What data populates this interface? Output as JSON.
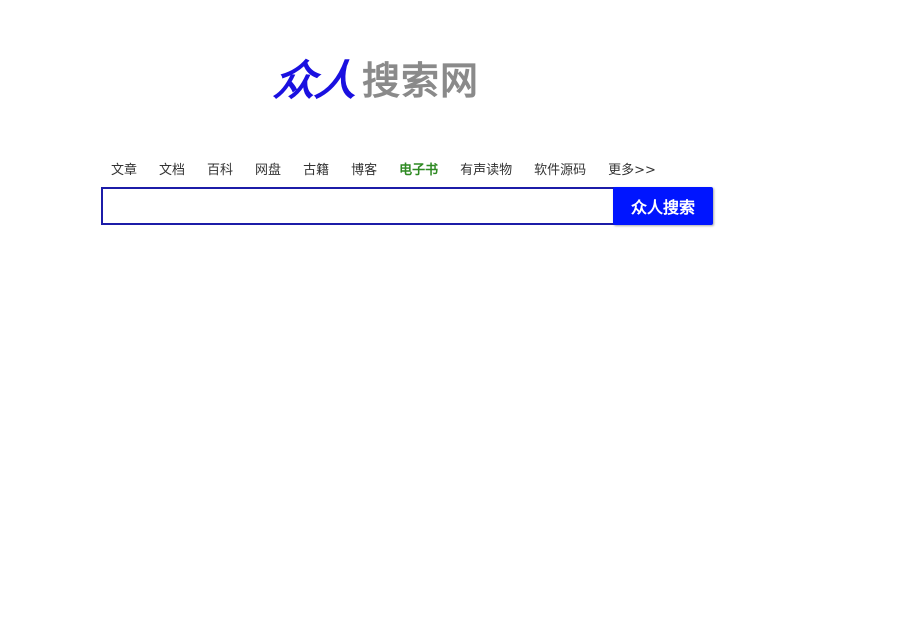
{
  "logo": {
    "part1": "众人",
    "part2": "搜索网"
  },
  "tabs": [
    {
      "label": "文章"
    },
    {
      "label": "文档"
    },
    {
      "label": "百科"
    },
    {
      "label": "网盘"
    },
    {
      "label": "古籍"
    },
    {
      "label": "博客"
    },
    {
      "label": "电子书"
    },
    {
      "label": "有声读物"
    },
    {
      "label": "软件源码"
    },
    {
      "label": "更多>>"
    }
  ],
  "active_tab": "电子书",
  "search": {
    "value": "",
    "placeholder": "",
    "button_label": "众人搜索"
  },
  "colors": {
    "brand_blue": "#1a10e0",
    "logo_gray": "#8a8a8a",
    "active_tab": "#2f8a23",
    "button_bg": "#0015ff",
    "input_border": "#1c1ca8"
  }
}
